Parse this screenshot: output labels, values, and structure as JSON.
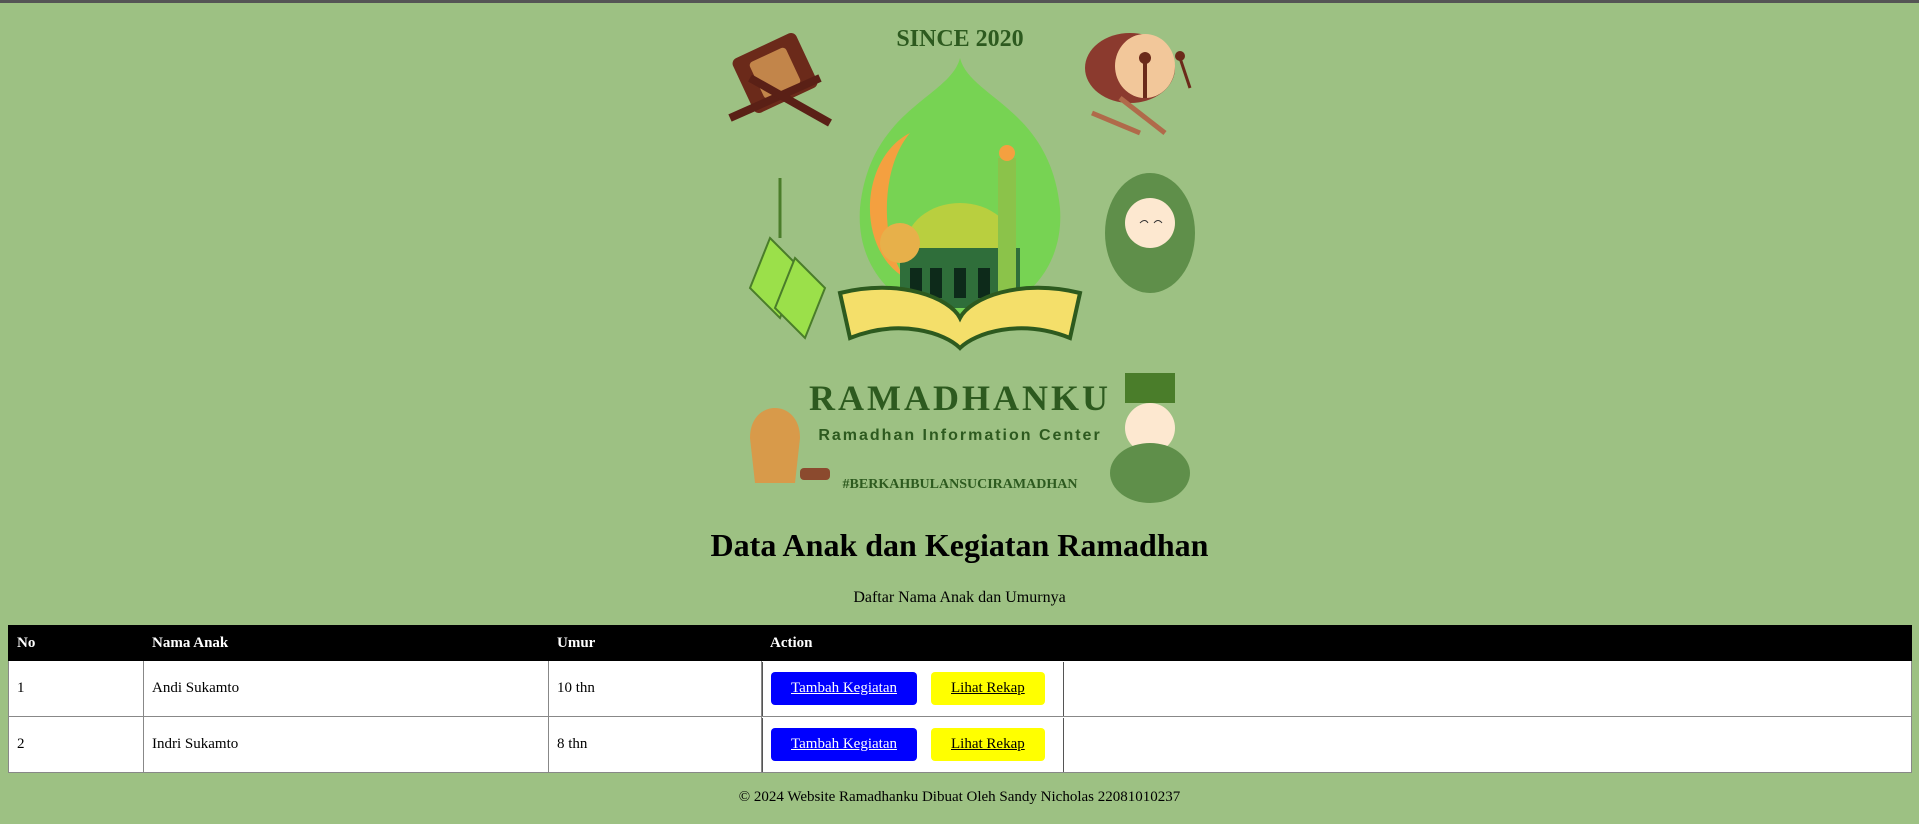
{
  "logo": {
    "since": "SINCE 2020",
    "brand": "RAMADHANKU",
    "tagline": "Ramadhan Information Center",
    "hashtag": "#BERKAHBULANSUCIRAMADHAN"
  },
  "header": {
    "title": "Data Anak dan Kegiatan Ramadhan",
    "subtitle": "Daftar Nama Anak dan Umurnya"
  },
  "table": {
    "columns": [
      "No",
      "Nama Anak",
      "Umur",
      "Action"
    ],
    "rows": [
      {
        "no": "1",
        "name": "Andi Sukamto",
        "age": "10 thn",
        "add_label": "Tambah Kegiatan",
        "view_label": "Lihat Rekap"
      },
      {
        "no": "2",
        "name": "Indri Sukamto",
        "age": "8 thn",
        "add_label": "Tambah Kegiatan",
        "view_label": "Lihat Rekap"
      }
    ]
  },
  "footer": {
    "text": "© 2024 Website Ramadhanku Dibuat Oleh Sandy Nicholas 22081010237"
  },
  "colors": {
    "page_bg": "#9dc183",
    "header_bg": "#000000",
    "primary_button": "#0000ff",
    "secondary_button": "#ffff00",
    "brand_green": "#2d5a1f"
  }
}
